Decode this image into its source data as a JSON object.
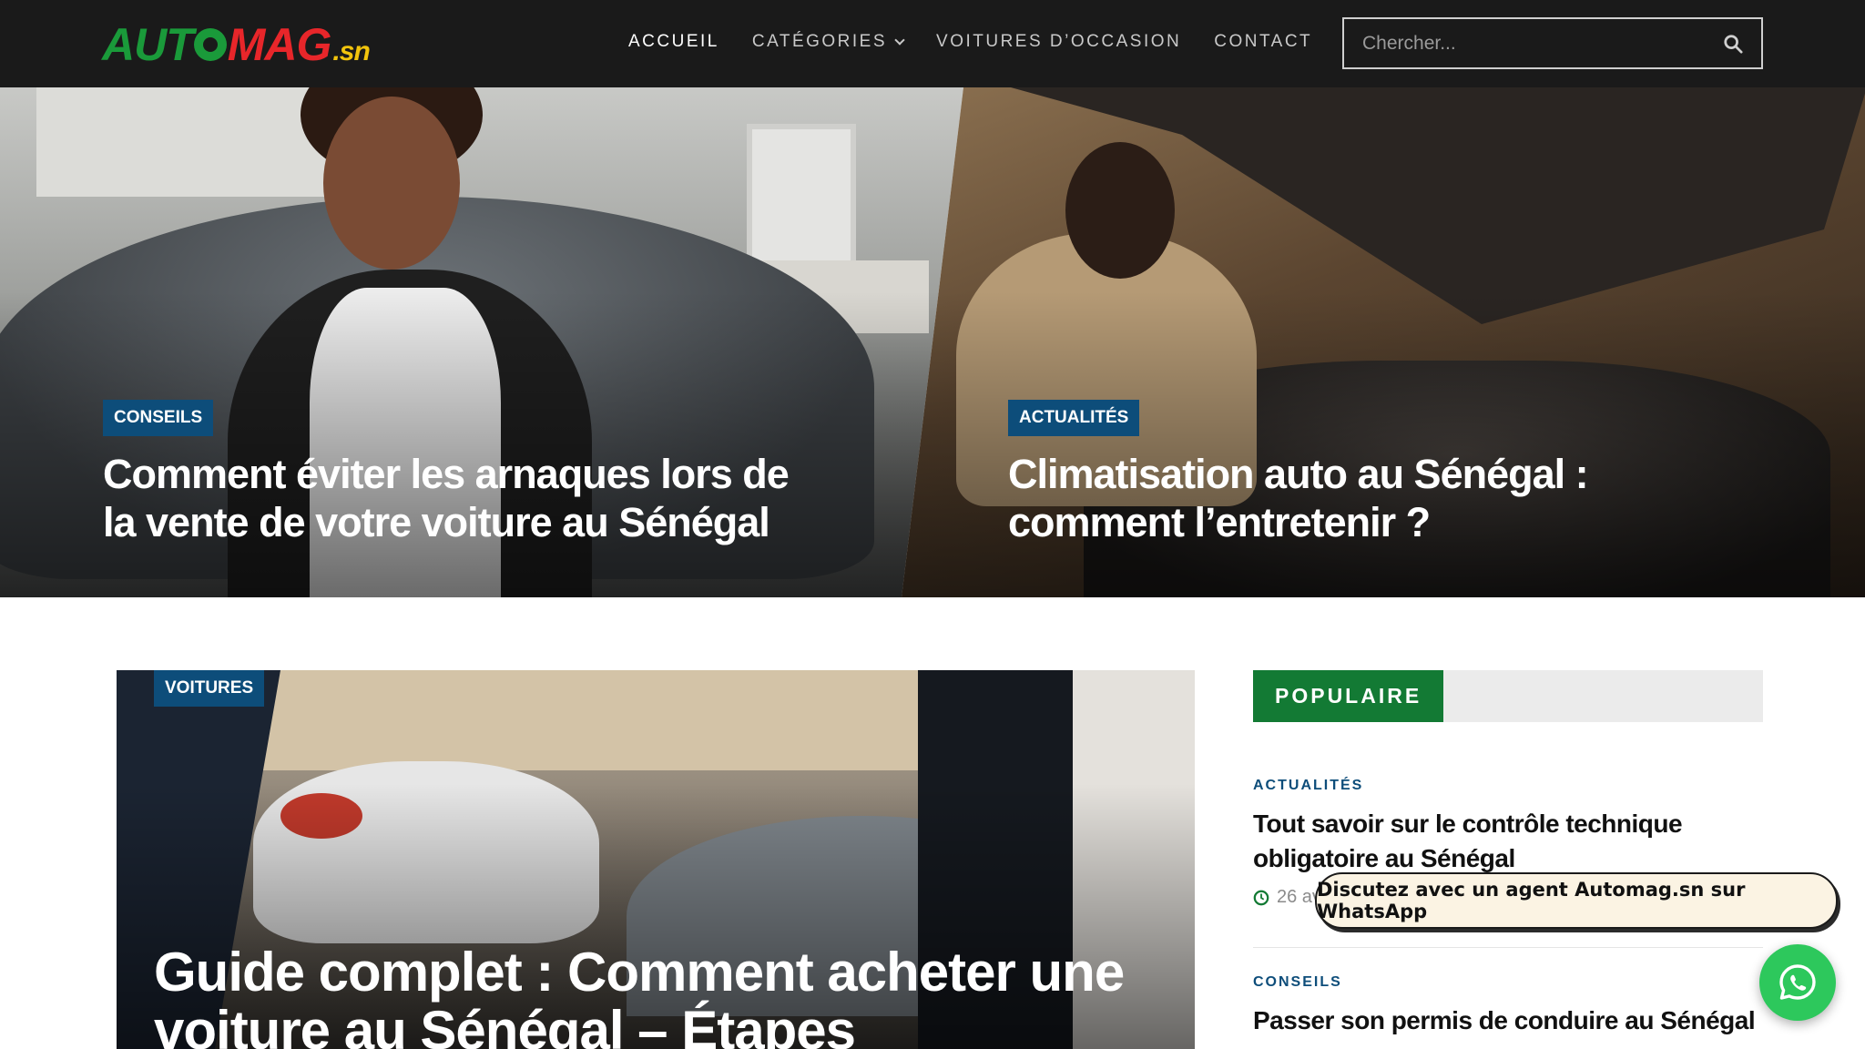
{
  "header": {
    "logo": {
      "auto": "AUT",
      "mag": "MAG",
      "sn": ".sn"
    },
    "nav": [
      {
        "label": "ACCUEIL"
      },
      {
        "label": "CATÉGORIES"
      },
      {
        "label": "VOITURES D’OCCASION"
      },
      {
        "label": "CONTACT"
      }
    ],
    "search": {
      "placeholder": "Chercher..."
    }
  },
  "hero": [
    {
      "category": "CONSEILS",
      "title": "Comment éviter les arnaques lors de la vente de votre voiture au Sénégal"
    },
    {
      "category": "ACTUALITÉS",
      "title": "Climatisation auto au Sénégal : comment l’entretenir ?"
    }
  ],
  "feature": {
    "category": "VOITURES",
    "title": "Guide complet : Comment acheter une voiture au Sénégal – Étapes"
  },
  "sidebar": {
    "heading": "POPULAIRE",
    "items": [
      {
        "category": "ACTUALITÉS",
        "title": "Tout savoir sur le contrôle technique obligatoire au Sénégal",
        "date": "26 av"
      },
      {
        "category": "CONSEILS",
        "title": "Passer son permis de conduire au Sénégal"
      }
    ]
  },
  "whatsapp": {
    "label": "Discutez avec un agent Automag.sn sur WhatsApp"
  },
  "colors": {
    "header_bg": "#1a1a1a",
    "category_bg": "#0d4d7a",
    "popular_green": "#137a34",
    "whatsapp_green": "#2dc85c"
  }
}
